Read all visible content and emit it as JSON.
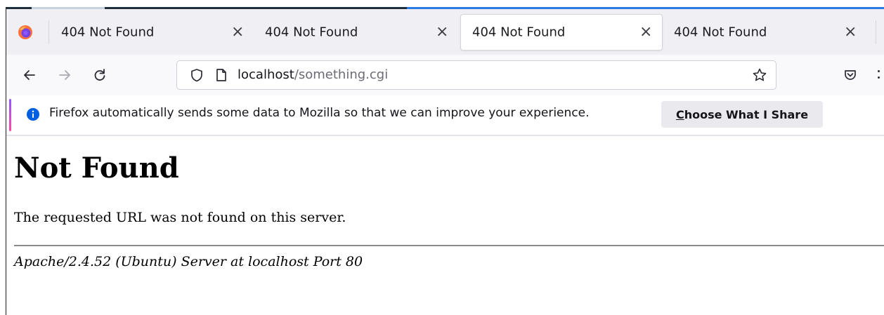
{
  "tabs": [
    {
      "title": "404 Not Found",
      "selected": false
    },
    {
      "title": "404 Not Found",
      "selected": false
    },
    {
      "title": "404 Not Found",
      "selected": true
    },
    {
      "title": "404 Not Found",
      "selected": false
    }
  ],
  "tab_close_glyph": "×",
  "urlbar": {
    "host": "localhost",
    "path": "/something.cgi"
  },
  "notification": {
    "message": "Firefox automatically sends some data to Mozilla so that we can improve your experience.",
    "button_accesskey": "C",
    "button_rest": "hoose What I Share"
  },
  "page": {
    "heading": "Not Found",
    "message": "The requested URL was not found on this server.",
    "address": "Apache/2.4.52 (Ubuntu) Server at localhost Port 80"
  },
  "icons": {
    "browser_logo": "firefox-logo-icon",
    "back": "back-arrow-icon",
    "forward": "forward-arrow-icon",
    "reload": "reload-icon",
    "tracking": "shield-icon",
    "page_info": "page-icon",
    "bookmark": "star-icon",
    "pocket": "pocket-icon",
    "info": "info-icon"
  },
  "colors": {
    "accent_blue": "#2a7be5",
    "info_blue": "#0060df",
    "tabstrip_bg": "#f0f0f4",
    "navbar_bg": "#f9f9fb",
    "notif_button_bg": "#e9e9ee"
  }
}
